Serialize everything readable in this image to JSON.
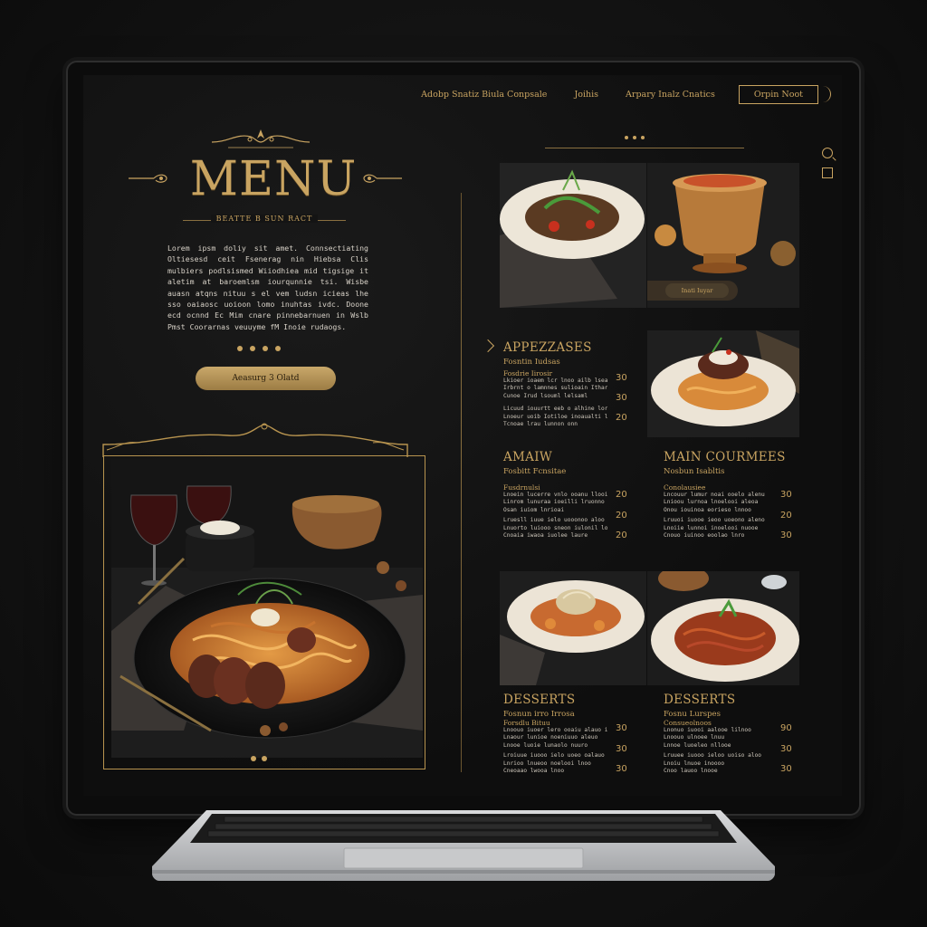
{
  "nav": {
    "links": [
      "Adobp Snatiz Biula Conpsale",
      "Joihis",
      "Arpary Inalz Cnatics"
    ],
    "cta": "Orpin Noot"
  },
  "hero": {
    "title": "MENU",
    "subtitle": "BEATTE B SUN RACT",
    "body": "Lorem ipsm doliy sit amet. Connsectiating Oltiesesd ceit Fsenerag nin Hiebsa Clis mulbiers podlsismed Wiiodhiea mid tigsige it aletim at baroemlsm iourqunnie tsi. Wisbe auasn atqns nituu s el vem ludsn icieas lhe sso oaiaosc uoioon lomo inuhtas ivdc. Doone ecd ocnnd Ec Mim cnare pinnebarnuen in Wslb Pmst Coorarnas veuuyme fM Inoie rudaogs.",
    "button": "Aeasurg 3 Olatd"
  },
  "photo_badge": "Inati Iuyar",
  "sections": {
    "appetizers": {
      "title": "APPEZZASES",
      "subtitle": "Fosntin Iudsas",
      "items": [
        {
          "name": "Fosdrie Iirosir",
          "desc": "Lkioer ioaem lcr lnoo ailb lsea.\nIrbrnt o lamnnes sulioain Ithar\nCunoe Irud lsouml lelsaml",
          "price": "30"
        },
        {
          "name": "",
          "desc": "",
          "price": "30"
        },
        {
          "name": "",
          "desc": "Licuud iouurtt eeb o alhine lore\nLnoeur uoib Iotiloe inoaualti lusi\nTcnoae lrau lunnon onn",
          "price": "20"
        }
      ]
    },
    "amaw": {
      "title": "AMAIW",
      "subtitle": "Fosbitt Fcnsitae",
      "items": [
        {
          "name": "Fusdrnulsi",
          "desc": "Lnoein lucerre vnlo ooanu llooie\nLinrom lunuraa ioeilli lruonno\nOsan iuiom lnrioai",
          "price": "20"
        },
        {
          "name": "",
          "desc": "Lruesll iuue ielo uooonoo aloo\nLnuorto luiooo sneon iulonil loo\nCnoaia iwaoa iuolee laure",
          "price": "20"
        },
        {
          "name": "",
          "desc": "",
          "price": "20"
        }
      ]
    },
    "main_courses": {
      "title": "MAIN COURMEES",
      "subtitle": "Nosbun Isabltis",
      "items": [
        {
          "name": "Conolausiee",
          "desc": "Lncouur lumur noai ooelo alenu\nLnioou lurnoa lnoelooi aleoa\nOnou iouinoa eorieso lnnoo",
          "price": "30"
        },
        {
          "name": "",
          "desc": "Lruuoi iuooe ieoo uoeono aleno\nLnoiie lunnoi inoelooi nuooe\nCnouo iuinoo eoolao lnro",
          "price": "20"
        },
        {
          "name": "",
          "desc": "",
          "price": "30"
        }
      ]
    },
    "desserts_left": {
      "title": "DESSERTS",
      "subtitle": "Fosnun irro Irrosa",
      "items": [
        {
          "name": "Forsdlu Bituu",
          "desc": "Lnoouo iuoer lero ooaiu alauo ileo\nLnaour lunioe noeniuuo aleuo\nLnooe luoie lunaolo nuuro",
          "price": "30"
        },
        {
          "name": "",
          "desc": "Lroiuue iuooo ielo uoeo oalauo\nLnrioo lnueoo noelooi lnoo\nCneoaao lwooa lnoo",
          "price": "30"
        },
        {
          "name": "",
          "desc": "",
          "price": "30"
        }
      ]
    },
    "desserts_right": {
      "title": "DESSERTS",
      "subtitle": "Fosnu Lurspes",
      "items": [
        {
          "name": "Consueolnoos",
          "desc": "Lnonuo iuooi aalooe lilnoo\nLnoouo ulnoee lnuu\nLnnoe luoeleo nllooe",
          "price": "90"
        },
        {
          "name": "",
          "desc": "Lruuee iuooo ieloo uoiso aloo\nLnoiu lnuoe inoooo\nCnoo lauoo lnooe",
          "price": "30"
        },
        {
          "name": "",
          "desc": "",
          "price": "30"
        }
      ]
    }
  },
  "colors": {
    "gold": "#c9a461",
    "background": "#0e0e0e",
    "text": "#d8d2c8"
  }
}
